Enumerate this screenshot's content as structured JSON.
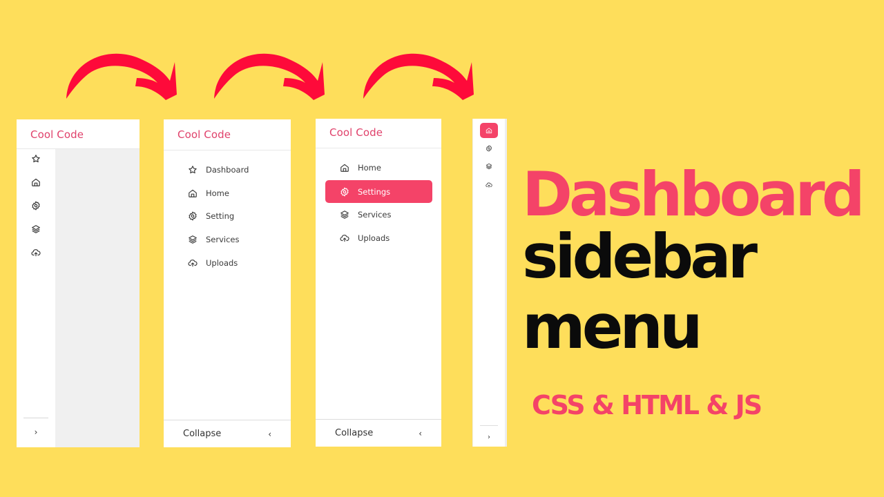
{
  "colors": {
    "background": "#fede5b",
    "accent": "#f44368",
    "arrow": "#fe0a3a",
    "text_dark": "#0b0b0b",
    "content_gray": "#f0f0f0"
  },
  "brand": "Cool Code",
  "panel1": {
    "state": "collapsed-with-content",
    "icons": [
      "star-icon",
      "home-icon",
      "gear-icon",
      "layers-icon",
      "cloud-upload-icon"
    ],
    "expand_chevron": "›"
  },
  "panel2": {
    "state": "expanded",
    "items": [
      {
        "label": "Dashboard",
        "icon": "star-icon"
      },
      {
        "label": "Home",
        "icon": "home-icon"
      },
      {
        "label": "Setting",
        "icon": "gear-icon"
      },
      {
        "label": "Services",
        "icon": "layers-icon"
      },
      {
        "label": "Uploads",
        "icon": "cloud-upload-icon"
      }
    ],
    "collapse_label": "Collapse",
    "collapse_chevron": "‹"
  },
  "panel3": {
    "state": "expanded-active",
    "items": [
      {
        "label": "Home",
        "icon": "home-icon",
        "active": false
      },
      {
        "label": "Settings",
        "icon": "gear-icon",
        "active": true
      },
      {
        "label": "Services",
        "icon": "layers-icon",
        "active": false
      },
      {
        "label": "Uploads",
        "icon": "cloud-upload-icon",
        "active": false
      }
    ],
    "collapse_label": "Collapse",
    "collapse_chevron": "‹"
  },
  "panel4": {
    "state": "mini",
    "icons": [
      "home-icon",
      "gear-icon",
      "layers-icon",
      "cloud-upload-icon"
    ],
    "active_index": 0,
    "expand_chevron": "›"
  },
  "headline": {
    "line1": "Dashboard",
    "line2": "sidebar",
    "line3": "menu",
    "subtitle": "CSS & HTML & JS"
  }
}
